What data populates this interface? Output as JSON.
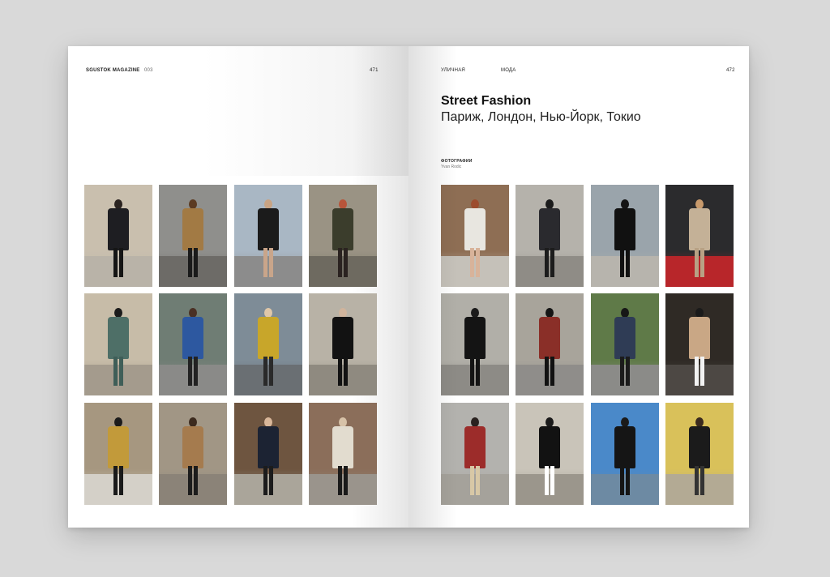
{
  "left_page": {
    "magazine": "SGUSTOK MAGAZINE",
    "issue": "003",
    "page_number": "471"
  },
  "right_page": {
    "section_1": "УЛИЧНАЯ",
    "section_2": "МОДА",
    "page_number": "472",
    "title": "Street Fashion",
    "subtitle": "Париж, Лондон, Нью-Йорк, Токио",
    "credits_label": "ФОТОГРАФИИ",
    "credits_name": "Yvan Rodic"
  },
  "photos": {
    "left": [
      {
        "bg": "#c9bfae",
        "ground": "#b9b3a8",
        "coat": "#1e1e22",
        "legs": "#151515",
        "head": "#2a2320"
      },
      {
        "bg": "#8f8f8c",
        "ground": "#6d6b67",
        "coat": "#a27a44",
        "legs": "#1a1a1a",
        "head": "#5c3b22"
      },
      {
        "bg": "#a9b7c4",
        "ground": "#8c8c8c",
        "coat": "#1b1b1b",
        "legs": "#c9a58a",
        "head": "#c9a484"
      },
      {
        "bg": "#9a9384",
        "ground": "#6e6a60",
        "coat": "#3b3d2c",
        "legs": "#2a2220",
        "head": "#b8553a"
      },
      {
        "bg": "#c7bca8",
        "ground": "#a49b8d",
        "coat": "#4e6f67",
        "legs": "#3f5e58",
        "head": "#1b1b1b"
      },
      {
        "bg": "#6f7d74",
        "ground": "#8a8a88",
        "coat": "#2d58a0",
        "legs": "#222222",
        "head": "#4a3024"
      },
      {
        "bg": "#7e8c97",
        "ground": "#6a6f73",
        "coat": "#c8a62a",
        "legs": "#2a2a2a",
        "head": "#e0c7a8"
      },
      {
        "bg": "#b8b2a6",
        "ground": "#8f8a80",
        "coat": "#121212",
        "legs": "#121212",
        "head": "#d0b49c"
      },
      {
        "bg": "#a69780",
        "ground": "#d4d0c8",
        "coat": "#c29a3a",
        "legs": "#1a1a1a",
        "head": "#1b1b1b"
      },
      {
        "bg": "#a19685",
        "ground": "#8b8378",
        "coat": "#a57b4e",
        "legs": "#1c1c1c",
        "head": "#3c2a1e"
      },
      {
        "bg": "#6e5540",
        "ground": "#aaa59a",
        "coat": "#1c2333",
        "legs": "#1c1c1c",
        "head": "#d9b79a"
      },
      {
        "bg": "#8b6e5a",
        "ground": "#9a948c",
        "coat": "#e2dccf",
        "legs": "#1a1a1a",
        "head": "#d7c2a8"
      }
    ],
    "right": [
      {
        "bg": "#8e6e54",
        "ground": "#c5c1b9",
        "coat": "#e8e6e0",
        "legs": "#d8b39a",
        "head": "#9c4c2e"
      },
      {
        "bg": "#b5b2ab",
        "ground": "#8f8c86",
        "coat": "#2a2a2e",
        "legs": "#1c1c1c",
        "head": "#1b1b1b"
      },
      {
        "bg": "#9aa4ab",
        "ground": "#b7b4ad",
        "coat": "#111111",
        "legs": "#111111",
        "head": "#141414"
      },
      {
        "bg": "#2b2b2d",
        "ground": "#b8262a",
        "coat": "#c4b197",
        "legs": "#b8a184",
        "head": "#c89a6c"
      },
      {
        "bg": "#b1afa8",
        "ground": "#8d8b86",
        "coat": "#141414",
        "legs": "#141414",
        "head": "#1b1b1b"
      },
      {
        "bg": "#a8a49b",
        "ground": "#8f8d8a",
        "coat": "#8a2f28",
        "legs": "#121212",
        "head": "#151515"
      },
      {
        "bg": "#5f7a48",
        "ground": "#8b8b88",
        "coat": "#2f3c55",
        "legs": "#1b1b1b",
        "head": "#171717"
      },
      {
        "bg": "#2f2a25",
        "ground": "#4d4844",
        "coat": "#c9a785",
        "legs": "#f2f2f2",
        "head": "#1a1a1a"
      },
      {
        "bg": "#b3b2ae",
        "ground": "#a5a29b",
        "coat": "#9c2c2a",
        "legs": "#d8c8a6",
        "head": "#2a2220"
      },
      {
        "bg": "#c9c4b9",
        "ground": "#9b968c",
        "coat": "#121212",
        "legs": "#ffffff",
        "head": "#1a1a1a"
      },
      {
        "bg": "#4a89c9",
        "ground": "#6d8aa3",
        "coat": "#151515",
        "legs": "#151515",
        "head": "#1b1b1b"
      },
      {
        "bg": "#d9c15a",
        "ground": "#b3aa94",
        "coat": "#1b1b1b",
        "legs": "#333333",
        "head": "#3a2a1e"
      }
    ]
  }
}
